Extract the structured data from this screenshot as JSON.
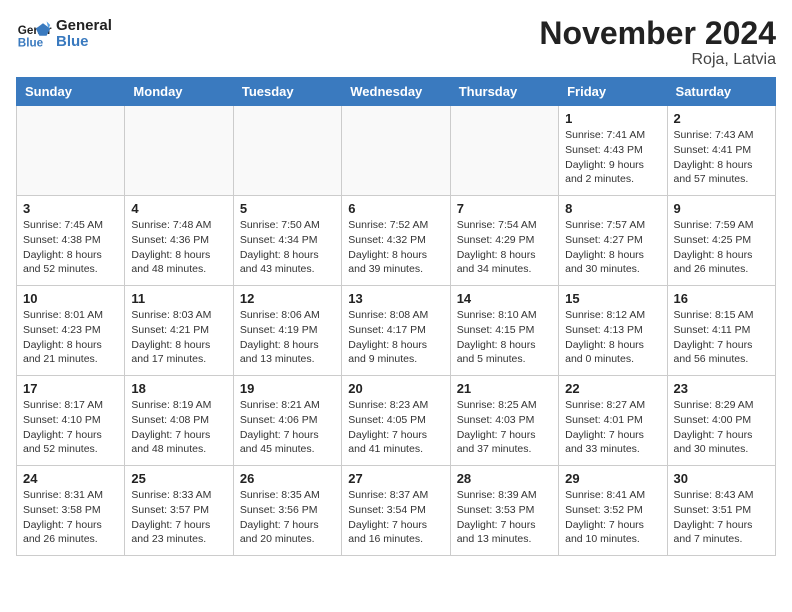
{
  "header": {
    "logo_line1": "General",
    "logo_line2": "Blue",
    "month": "November 2024",
    "location": "Roja, Latvia"
  },
  "weekdays": [
    "Sunday",
    "Monday",
    "Tuesday",
    "Wednesday",
    "Thursday",
    "Friday",
    "Saturday"
  ],
  "weeks": [
    [
      {
        "day": "",
        "info": ""
      },
      {
        "day": "",
        "info": ""
      },
      {
        "day": "",
        "info": ""
      },
      {
        "day": "",
        "info": ""
      },
      {
        "day": "",
        "info": ""
      },
      {
        "day": "1",
        "info": "Sunrise: 7:41 AM\nSunset: 4:43 PM\nDaylight: 9 hours\nand 2 minutes."
      },
      {
        "day": "2",
        "info": "Sunrise: 7:43 AM\nSunset: 4:41 PM\nDaylight: 8 hours\nand 57 minutes."
      }
    ],
    [
      {
        "day": "3",
        "info": "Sunrise: 7:45 AM\nSunset: 4:38 PM\nDaylight: 8 hours\nand 52 minutes."
      },
      {
        "day": "4",
        "info": "Sunrise: 7:48 AM\nSunset: 4:36 PM\nDaylight: 8 hours\nand 48 minutes."
      },
      {
        "day": "5",
        "info": "Sunrise: 7:50 AM\nSunset: 4:34 PM\nDaylight: 8 hours\nand 43 minutes."
      },
      {
        "day": "6",
        "info": "Sunrise: 7:52 AM\nSunset: 4:32 PM\nDaylight: 8 hours\nand 39 minutes."
      },
      {
        "day": "7",
        "info": "Sunrise: 7:54 AM\nSunset: 4:29 PM\nDaylight: 8 hours\nand 34 minutes."
      },
      {
        "day": "8",
        "info": "Sunrise: 7:57 AM\nSunset: 4:27 PM\nDaylight: 8 hours\nand 30 minutes."
      },
      {
        "day": "9",
        "info": "Sunrise: 7:59 AM\nSunset: 4:25 PM\nDaylight: 8 hours\nand 26 minutes."
      }
    ],
    [
      {
        "day": "10",
        "info": "Sunrise: 8:01 AM\nSunset: 4:23 PM\nDaylight: 8 hours\nand 21 minutes."
      },
      {
        "day": "11",
        "info": "Sunrise: 8:03 AM\nSunset: 4:21 PM\nDaylight: 8 hours\nand 17 minutes."
      },
      {
        "day": "12",
        "info": "Sunrise: 8:06 AM\nSunset: 4:19 PM\nDaylight: 8 hours\nand 13 minutes."
      },
      {
        "day": "13",
        "info": "Sunrise: 8:08 AM\nSunset: 4:17 PM\nDaylight: 8 hours\nand 9 minutes."
      },
      {
        "day": "14",
        "info": "Sunrise: 8:10 AM\nSunset: 4:15 PM\nDaylight: 8 hours\nand 5 minutes."
      },
      {
        "day": "15",
        "info": "Sunrise: 8:12 AM\nSunset: 4:13 PM\nDaylight: 8 hours\nand 0 minutes."
      },
      {
        "day": "16",
        "info": "Sunrise: 8:15 AM\nSunset: 4:11 PM\nDaylight: 7 hours\nand 56 minutes."
      }
    ],
    [
      {
        "day": "17",
        "info": "Sunrise: 8:17 AM\nSunset: 4:10 PM\nDaylight: 7 hours\nand 52 minutes."
      },
      {
        "day": "18",
        "info": "Sunrise: 8:19 AM\nSunset: 4:08 PM\nDaylight: 7 hours\nand 48 minutes."
      },
      {
        "day": "19",
        "info": "Sunrise: 8:21 AM\nSunset: 4:06 PM\nDaylight: 7 hours\nand 45 minutes."
      },
      {
        "day": "20",
        "info": "Sunrise: 8:23 AM\nSunset: 4:05 PM\nDaylight: 7 hours\nand 41 minutes."
      },
      {
        "day": "21",
        "info": "Sunrise: 8:25 AM\nSunset: 4:03 PM\nDaylight: 7 hours\nand 37 minutes."
      },
      {
        "day": "22",
        "info": "Sunrise: 8:27 AM\nSunset: 4:01 PM\nDaylight: 7 hours\nand 33 minutes."
      },
      {
        "day": "23",
        "info": "Sunrise: 8:29 AM\nSunset: 4:00 PM\nDaylight: 7 hours\nand 30 minutes."
      }
    ],
    [
      {
        "day": "24",
        "info": "Sunrise: 8:31 AM\nSunset: 3:58 PM\nDaylight: 7 hours\nand 26 minutes."
      },
      {
        "day": "25",
        "info": "Sunrise: 8:33 AM\nSunset: 3:57 PM\nDaylight: 7 hours\nand 23 minutes."
      },
      {
        "day": "26",
        "info": "Sunrise: 8:35 AM\nSunset: 3:56 PM\nDaylight: 7 hours\nand 20 minutes."
      },
      {
        "day": "27",
        "info": "Sunrise: 8:37 AM\nSunset: 3:54 PM\nDaylight: 7 hours\nand 16 minutes."
      },
      {
        "day": "28",
        "info": "Sunrise: 8:39 AM\nSunset: 3:53 PM\nDaylight: 7 hours\nand 13 minutes."
      },
      {
        "day": "29",
        "info": "Sunrise: 8:41 AM\nSunset: 3:52 PM\nDaylight: 7 hours\nand 10 minutes."
      },
      {
        "day": "30",
        "info": "Sunrise: 8:43 AM\nSunset: 3:51 PM\nDaylight: 7 hours\nand 7 minutes."
      }
    ]
  ]
}
